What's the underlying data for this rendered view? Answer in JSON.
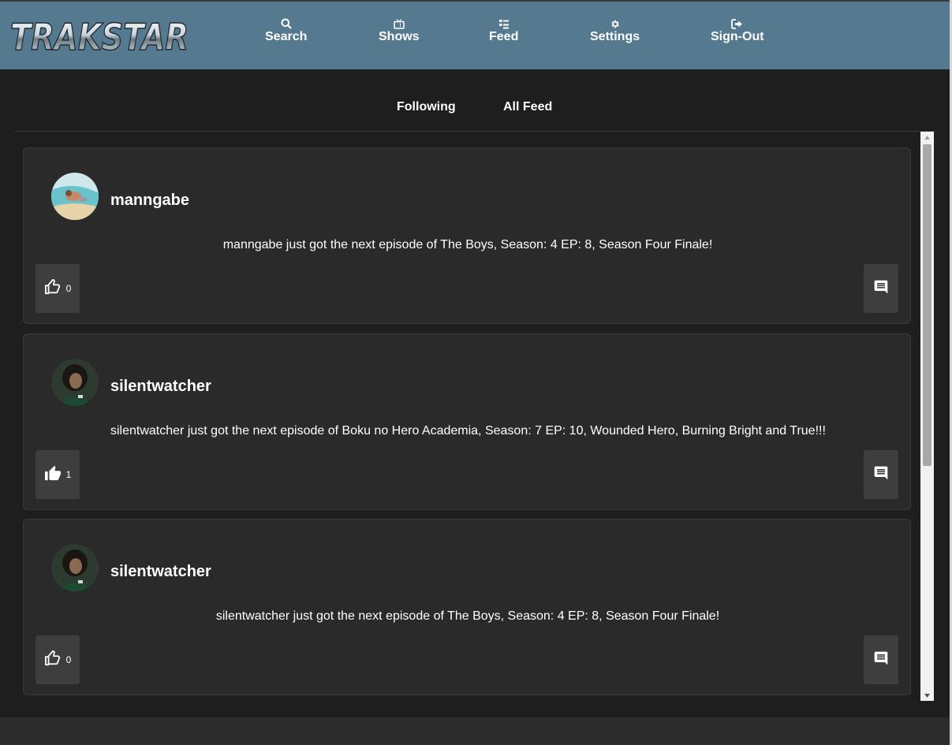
{
  "app": {
    "logo_text": "TRAKSTAR"
  },
  "nav": {
    "items": [
      {
        "label": "Search",
        "icon": "search-icon"
      },
      {
        "label": "Shows",
        "icon": "tv-icon"
      },
      {
        "label": "Feed",
        "icon": "list-icon"
      },
      {
        "label": "Settings",
        "icon": "gear-icon"
      },
      {
        "label": "Sign-Out",
        "icon": "sign-out-icon"
      }
    ]
  },
  "tabs": [
    {
      "label": "Following"
    },
    {
      "label": "All Feed"
    }
  ],
  "feed": {
    "posts": [
      {
        "username": "manngabe",
        "message": "manngabe just got the next episode of The Boys, Season: 4 EP: 8, Season Four Finale!",
        "likes": "0",
        "liked": false
      },
      {
        "username": "silentwatcher",
        "message": "silentwatcher just got the next episode of Boku no Hero Academia, Season: 7 EP: 10, Wounded Hero, Burning Bright and True!!!",
        "likes": "1",
        "liked": true
      },
      {
        "username": "silentwatcher",
        "message": "silentwatcher just got the next episode of The Boys, Season: 4 EP: 8, Season Four Finale!",
        "likes": "0",
        "liked": false
      }
    ]
  },
  "colors": {
    "nav_bg": "#557a8f",
    "page_bg": "#1e1e1e",
    "card_bg": "#2a2a2a",
    "button_bg": "#3e3e3e"
  }
}
